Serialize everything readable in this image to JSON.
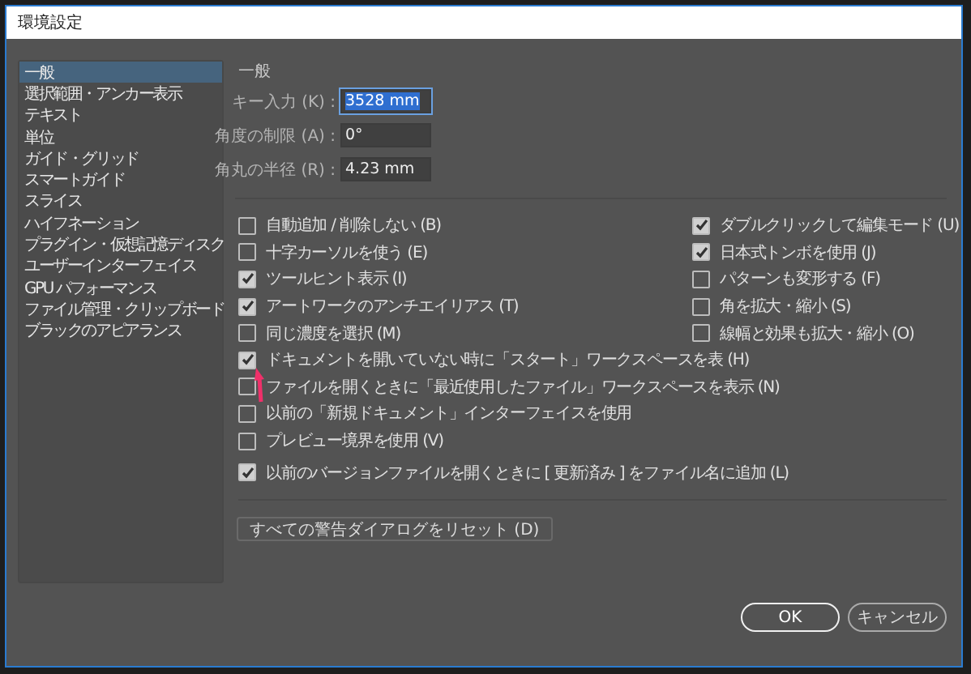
{
  "window": {
    "title": "環境設定"
  },
  "sidebar": {
    "items": [
      {
        "label": "一般",
        "selected": true
      },
      {
        "label": "選択範囲・アンカー表示",
        "selected": false
      },
      {
        "label": "テキスト",
        "selected": false
      },
      {
        "label": "単位",
        "selected": false
      },
      {
        "label": "ガイド・グリッド",
        "selected": false
      },
      {
        "label": "スマートガイド",
        "selected": false
      },
      {
        "label": "スライス",
        "selected": false
      },
      {
        "label": "ハイフネーション",
        "selected": false
      },
      {
        "label": "プラグイン・仮想記憶ディスク",
        "selected": false
      },
      {
        "label": "ユーザーインターフェイス",
        "selected": false
      },
      {
        "label": "GPU パフォーマンス",
        "selected": false
      },
      {
        "label": "ファイル管理・クリップボード",
        "selected": false
      },
      {
        "label": "ブラックのアピアランス",
        "selected": false
      }
    ]
  },
  "section_title": "一般",
  "fields": [
    {
      "label": "キー入力 (K) :",
      "value": "3528 mm",
      "focused": true
    },
    {
      "label": "角度の制限 (A) :",
      "value": "0°",
      "focused": false
    },
    {
      "label": "角丸の半径 (R) :",
      "value": "4.23 mm",
      "focused": false
    }
  ],
  "options_left": [
    {
      "label": "自動追加 / 削除しない (B)",
      "checked": false
    },
    {
      "label": "十字カーソルを使う (E)",
      "checked": false
    },
    {
      "label": "ツールヒント表示 (I)",
      "checked": true
    },
    {
      "label": "アートワークのアンチエイリアス (T)",
      "checked": true
    },
    {
      "label": "同じ濃度を選択 (M)",
      "checked": false
    },
    {
      "label": "ドキュメントを開いていない時に「スタート」ワークスペースを表 (H)",
      "checked": true
    },
    {
      "label": "ファイルを開くときに「最近使用したファイル」ワークスペースを表示 (N)",
      "checked": false
    },
    {
      "label": "以前の「新規ドキュメント」インターフェイスを使用",
      "checked": false
    },
    {
      "label": "プレビュー境界を使用 (V)",
      "checked": false
    }
  ],
  "options_right": [
    {
      "label": "ダブルクリックして編集モード (U)",
      "checked": true
    },
    {
      "label": "日本式トンボを使用 (J)",
      "checked": true
    },
    {
      "label": "パターンも変形する (F)",
      "checked": false
    },
    {
      "label": "角を拡大・縮小 (S)",
      "checked": false
    },
    {
      "label": "線幅と効果も拡大・縮小 (O)",
      "checked": false
    }
  ],
  "bottom_option": {
    "label": "以前のバージョンファイルを開くときに [ 更新済み ] をファイル名に追加 (L)",
    "checked": true
  },
  "reset_button": "すべての警告ダイアログをリセット (D)",
  "buttons": [
    {
      "label": "OK",
      "kind": "default"
    },
    {
      "label": "キャンセル",
      "kind": "normal"
    }
  ]
}
